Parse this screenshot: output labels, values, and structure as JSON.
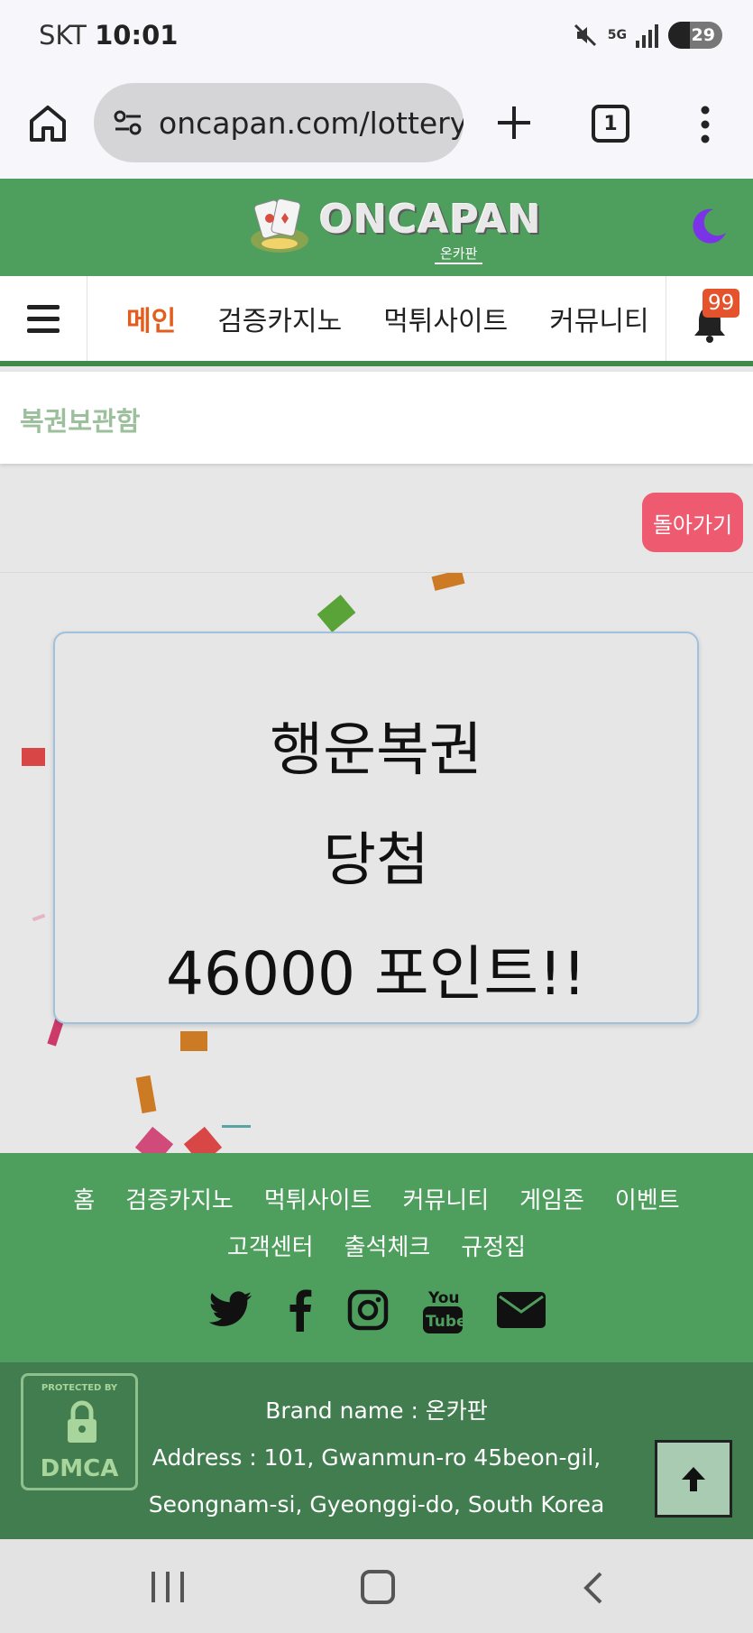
{
  "status_bar": {
    "carrier": "SKT",
    "time": "10:01",
    "network": "5G",
    "battery": "29",
    "icons": [
      "mute-icon",
      "signal-icon",
      "battery-charging-icon"
    ]
  },
  "browser": {
    "url": "oncapan.com/lottery",
    "tab_count": "1",
    "icons": [
      "home-icon",
      "site-settings-icon",
      "new-tab-icon",
      "tabs-icon",
      "more-menu-icon"
    ]
  },
  "header": {
    "logo_text": "ONCAPAN",
    "logo_subtext": "온카판",
    "theme_icon": "moon-icon",
    "colors": {
      "header_green": "#4e9e5d",
      "footer_dark_green": "#427d50"
    }
  },
  "nav": {
    "items": [
      {
        "label": "메인",
        "active": true
      },
      {
        "label": "검증카지노",
        "active": false
      },
      {
        "label": "먹튀사이트",
        "active": false
      },
      {
        "label": "커뮤니티",
        "active": false
      }
    ],
    "notification_count": "99",
    "active_color": "#e35d1e"
  },
  "page": {
    "title": "복권보관함",
    "back_label": "돌아가기"
  },
  "lottery": {
    "title": "행운복권",
    "result": "당첨",
    "points": "46000 포인트!!"
  },
  "footer": {
    "links_row1": [
      "홈",
      "검증카지노",
      "먹튀사이트",
      "커뮤니티",
      "게임존",
      "이벤트"
    ],
    "links_row2": [
      "고객센터",
      "출석체크",
      "규정집"
    ],
    "social_icons": [
      "twitter-icon",
      "facebook-icon",
      "instagram-icon",
      "youtube-icon",
      "email-icon"
    ],
    "dmca_top": "PROTECTED BY",
    "dmca_main": "DMCA",
    "brand": "Brand name : 온카판",
    "address_line1": "Address : 101, Gwanmun-ro 45beon-gil,",
    "address_line2": "Seongnam-si, Gyeonggi-do, South Korea"
  }
}
